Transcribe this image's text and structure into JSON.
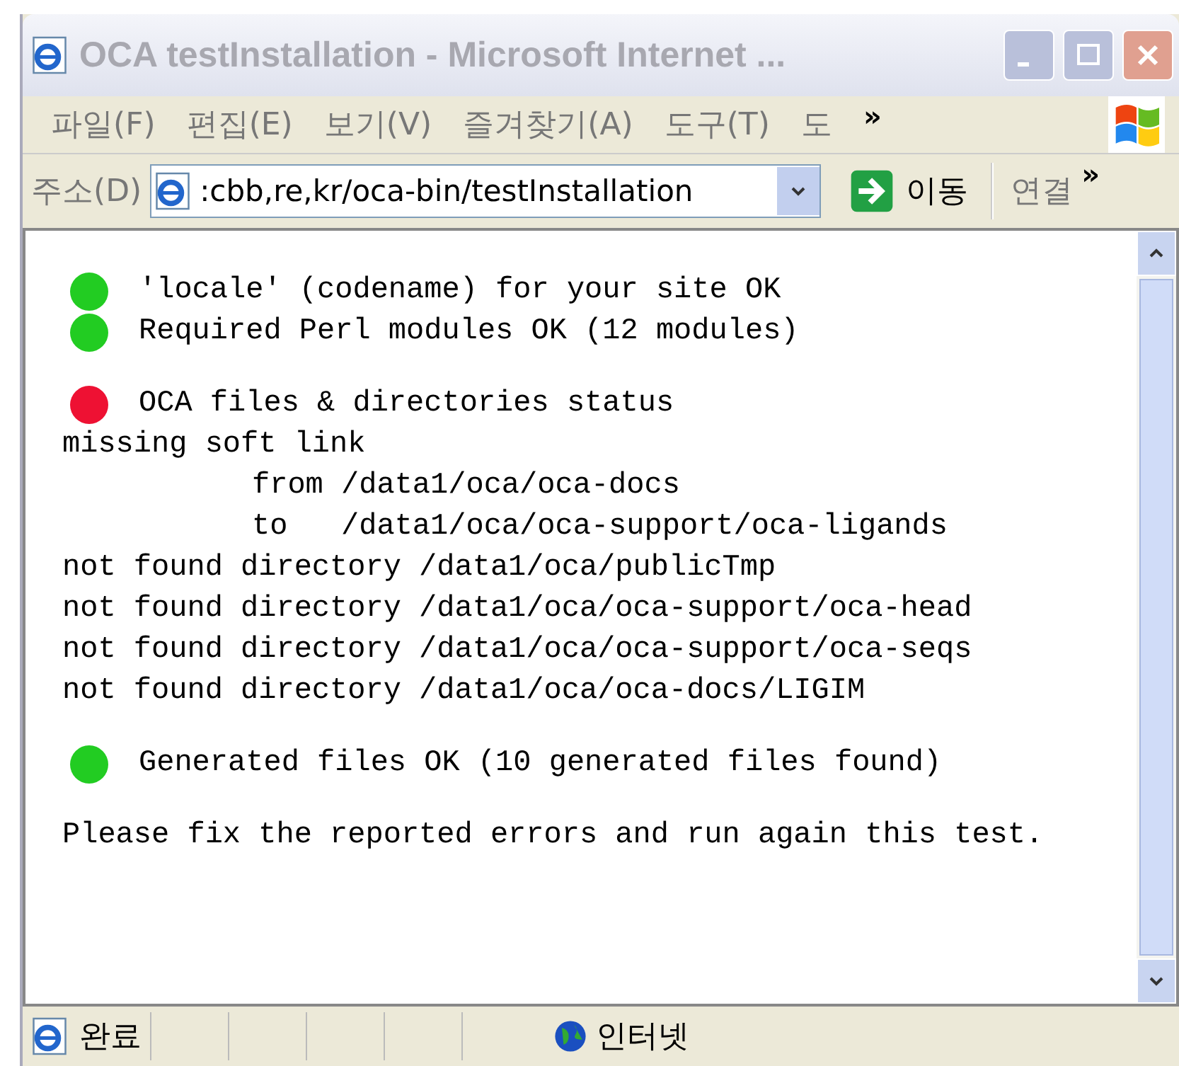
{
  "window": {
    "title": "OCA testInstallation - Microsoft Internet ...",
    "active": false
  },
  "menu": [
    "파일(F)",
    "편집(E)",
    "보기(V)",
    "즐겨찾기(A)",
    "도구(T)",
    "도"
  ],
  "menu_overflow": "»",
  "address_bar": {
    "label": "주소(D)",
    "value": ":cbb,re,kr/oca-bin/testInstallation",
    "go": "이동",
    "links": "연결",
    "links_overflow": "»"
  },
  "blocks": [
    {
      "lines": [
        {
          "kind": "status",
          "color": "#22cc22",
          "text": "'locale' (codename) for your site OK"
        },
        {
          "kind": "status",
          "color": "#22cc22",
          "text": "Required Perl modules OK (12 modules)"
        }
      ]
    },
    {
      "lines": [
        {
          "kind": "status",
          "color": "#ee1133",
          "text": "OCA files & directories status"
        },
        {
          "kind": "text",
          "text": "missing soft link"
        },
        {
          "kind": "indented",
          "text": "from /data1/oca/oca-docs"
        },
        {
          "kind": "indented",
          "text": "to   /data1/oca/oca-support/oca-ligands"
        },
        {
          "kind": "text",
          "text": "not found directory /data1/oca/publicTmp"
        },
        {
          "kind": "text",
          "text": "not found directory /data1/oca/oca-support/oca-head"
        },
        {
          "kind": "text",
          "text": "not found directory /data1/oca/oca-support/oca-seqs"
        },
        {
          "kind": "text",
          "text": "not found directory /data1/oca/oca-docs/LIGIM"
        }
      ]
    },
    {
      "lines": [
        {
          "kind": "status",
          "color": "#22cc22",
          "text": "Generated files OK (10 generated files found)"
        }
      ]
    },
    {
      "lines": [
        {
          "kind": "text",
          "text": "Please fix the reported errors and run again this test."
        }
      ]
    }
  ],
  "status_bar": {
    "text": "완료",
    "zone": "인터넷"
  }
}
